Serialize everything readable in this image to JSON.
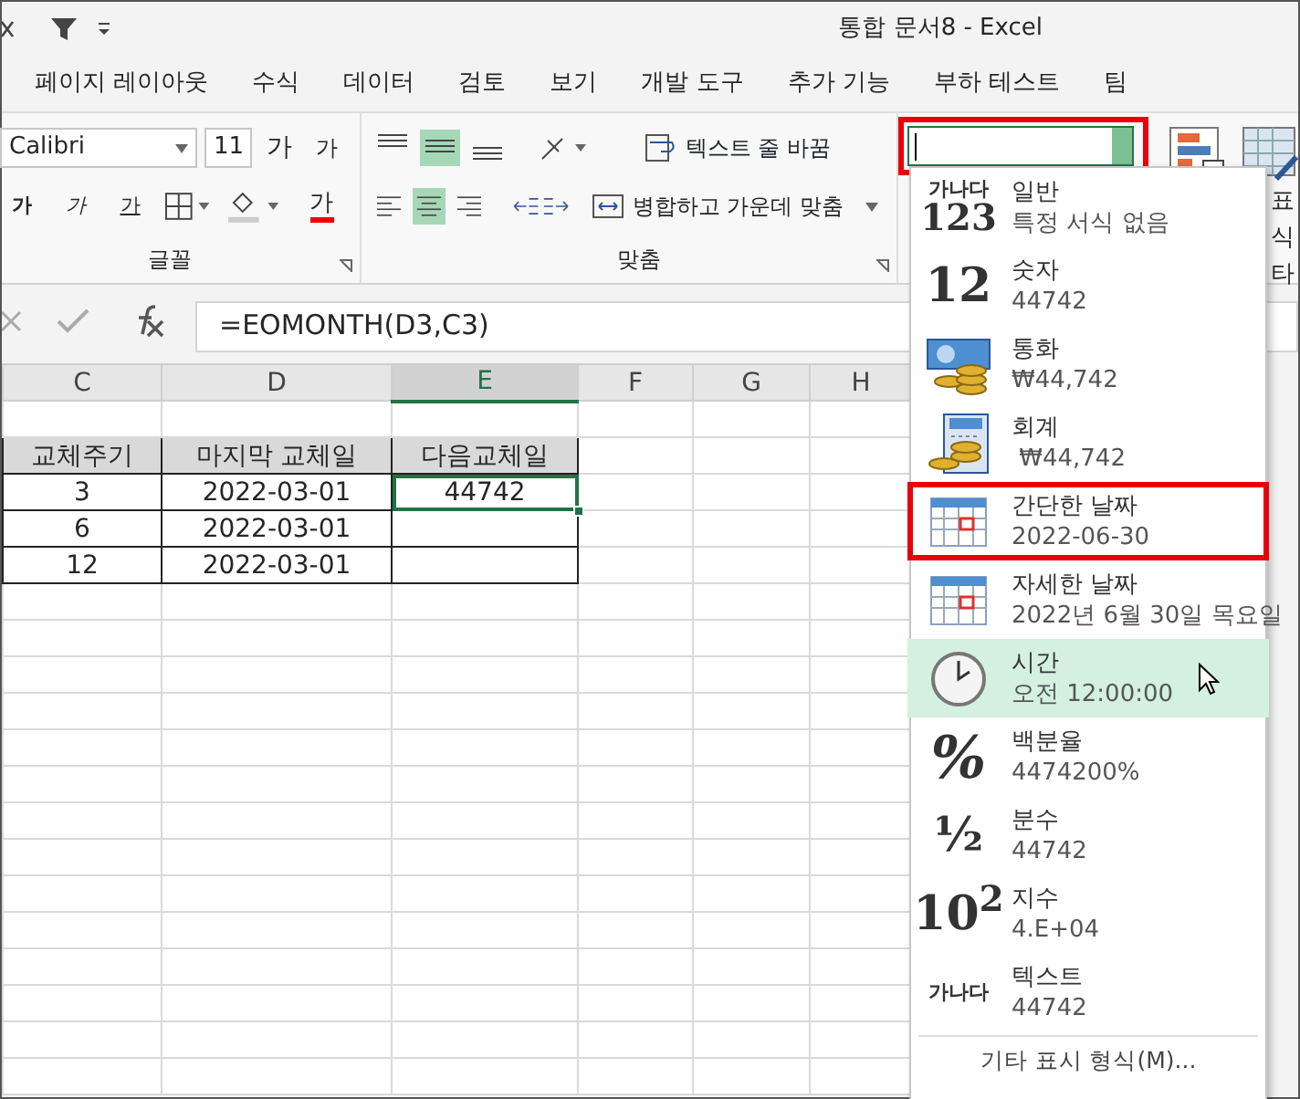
{
  "title_bar": {
    "title": "통합 문서8 - Excel"
  },
  "tabs": [
    "페이지 레이아웃",
    "수식",
    "데이터",
    "검토",
    "보기",
    "개발 도구",
    "추가 기능",
    "부하 테스트",
    "팀"
  ],
  "ribbon": {
    "font_name": "Calibri",
    "font_size": "11",
    "grow_font": "가",
    "shrink_font": "가",
    "style_buttons": [
      "가",
      "가",
      "가"
    ],
    "font_color": "가",
    "font_group": "글꼴",
    "alignment": [
      {
        "kind": "top",
        "selected": false
      },
      {
        "kind": "middle",
        "selected": true
      },
      {
        "kind": "bottom",
        "selected": false
      },
      {
        "kind": "left",
        "selected": false
      },
      {
        "kind": "center",
        "selected": true
      },
      {
        "kind": "right",
        "selected": false
      }
    ],
    "wrap_text": "텍스트 줄 바꿈",
    "merge": "병합하고 가운데 맞춤",
    "alignment_group": "맞춤",
    "number_format": {
      "annotated": true
    },
    "cut_labels": [
      "표",
      "식",
      "타"
    ]
  },
  "formula_bar": {
    "formula": "=EOMONTH(D3,C3)"
  },
  "sheet": {
    "columns": [
      {
        "label": "C",
        "selected": false
      },
      {
        "label": "D",
        "selected": false
      },
      {
        "label": "E",
        "selected": true
      },
      {
        "label": "F",
        "selected": false
      },
      {
        "label": "G",
        "selected": false
      },
      {
        "label": "H",
        "selected": false
      }
    ],
    "rows": [
      {
        "kind": "blank",
        "cells": []
      },
      {
        "kind": "header",
        "cells": [
          {
            "text": "교체주기",
            "selected": false
          },
          {
            "text": "마지막 교체일",
            "selected": false
          },
          {
            "text": "다음교체일",
            "selected": false
          }
        ]
      },
      {
        "kind": "data",
        "cells": [
          {
            "text": "3",
            "selected": false
          },
          {
            "text": "2022-03-01",
            "selected": false
          },
          {
            "text": "44742",
            "selected": true
          }
        ]
      },
      {
        "kind": "data",
        "cells": [
          {
            "text": "6",
            "selected": false
          },
          {
            "text": "2022-03-01",
            "selected": false
          },
          {
            "selected": false
          }
        ]
      },
      {
        "kind": "data",
        "cells": [
          {
            "text": "12",
            "selected": false
          },
          {
            "text": "2022-03-01",
            "selected": false
          },
          {
            "selected": false
          }
        ]
      }
    ]
  },
  "format_menu": {
    "items": [
      {
        "kind": "general",
        "icon_lines": [
          "가나다",
          "123"
        ],
        "name": "일반",
        "sample": "특정 서식 없음",
        "hovered": false,
        "annotated": false
      },
      {
        "kind": "number",
        "icon_lines": [
          "12"
        ],
        "name": "숫자",
        "sample": "44742",
        "hovered": false,
        "annotated": false
      },
      {
        "kind": "currency",
        "name": "통화",
        "sample": "₩44,742",
        "hovered": false,
        "annotated": false
      },
      {
        "kind": "accounting",
        "name": "회계",
        "sample": " ₩44,742",
        "hovered": false,
        "annotated": false
      },
      {
        "kind": "short_date",
        "name": "간단한 날짜",
        "sample": "2022-06-30",
        "hovered": false,
        "annotated": true
      },
      {
        "kind": "long_date",
        "name": "자세한 날짜",
        "sample": "2022년 6월 30일 목요일",
        "hovered": false,
        "annotated": false
      },
      {
        "kind": "time",
        "name": "시간",
        "sample": "오전 12:00:00",
        "hovered": true,
        "annotated": false
      },
      {
        "kind": "percent",
        "icon_lines": [
          "%"
        ],
        "name": "백분율",
        "sample": "4474200%",
        "hovered": false,
        "annotated": false
      },
      {
        "kind": "fraction",
        "icon_lines": [
          "½"
        ],
        "name": "분수",
        "sample": "44742",
        "hovered": false,
        "annotated": false
      },
      {
        "kind": "scientific",
        "icon_lines": [
          "10$^{2}$"
        ],
        "name": "지수",
        "sample": "4.E+04",
        "hovered": false,
        "annotated": false
      },
      {
        "kind": "text",
        "icon_lines": [
          "가나다"
        ],
        "name": "텍스트",
        "sample": "44742",
        "hovered": false,
        "annotated": false
      }
    ],
    "footer": "기타 표시 형식(M)..."
  }
}
